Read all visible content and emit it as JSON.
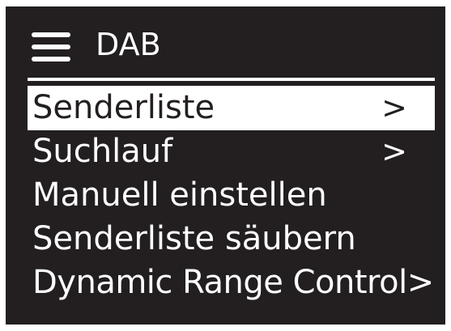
{
  "header": {
    "icon": "hamburger-menu-icon",
    "title": "DAB"
  },
  "colors": {
    "screen_background": "#231f20",
    "foreground": "#ffffff",
    "selection_background": "#ffffff",
    "selection_text": "#231f20"
  },
  "menu": {
    "selected_index": 0,
    "items": [
      {
        "label": "Senderliste",
        "arrow": ">"
      },
      {
        "label": "Suchlauf",
        "arrow": ">"
      },
      {
        "label": "Manuell einstellen",
        "arrow": ""
      },
      {
        "label": "Senderliste säubern",
        "arrow": ""
      },
      {
        "label": "Dynamic Range Control>",
        "arrow": ""
      }
    ]
  }
}
